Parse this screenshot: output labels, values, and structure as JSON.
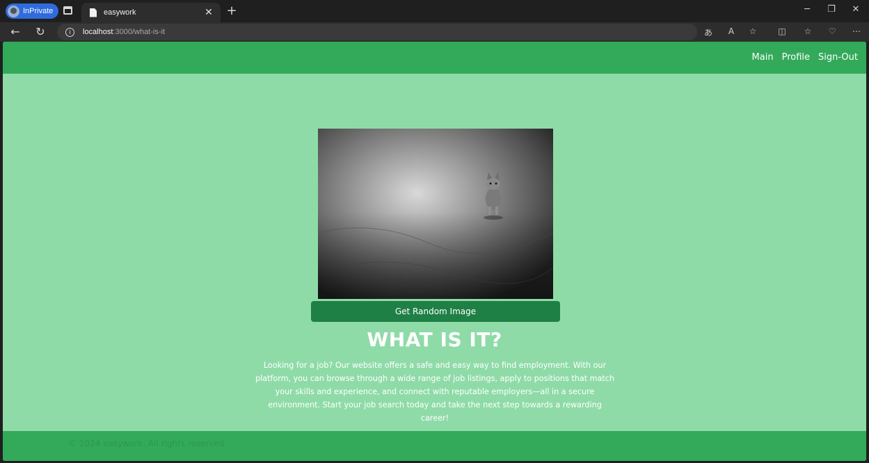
{
  "browser": {
    "inprivate_label": "InPrivate",
    "tab_title": "easywork",
    "url_host": "localhost",
    "url_path": ":3000/what-is-it"
  },
  "nav": {
    "main": "Main",
    "profile": "Profile",
    "signout": "Sign-Out"
  },
  "main": {
    "image_alt": "random image",
    "button_label": "Get Random Image",
    "heading": "WHAT IS IT?",
    "description": "Looking for a job? Our website offers a safe and easy way to find employment. With our platform, you can browse through a wide range of job listings, apply to positions that match your skills and experience, and connect with reputable employers—all in a secure environment. Start your job search today and take the next step towards a rewarding career!"
  },
  "footer": {
    "copyright": "© 2024 easywork. All rights reserved."
  },
  "colors": {
    "header": "#33aa5a",
    "page_bg": "#8fdba8",
    "button": "#1f8046"
  }
}
